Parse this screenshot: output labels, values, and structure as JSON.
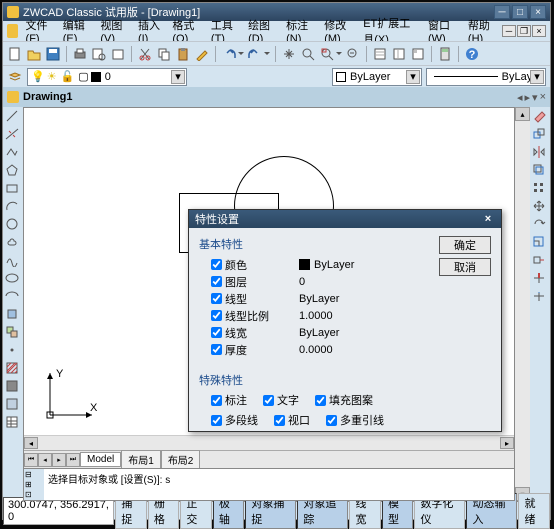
{
  "title": "ZWCAD Classic 试用版 - [Drawing1]",
  "menus": [
    "文件(F)",
    "编辑(E)",
    "视图(V)",
    "插入(I)",
    "格式(O)",
    "工具(T)",
    "绘图(D)",
    "标注(N)",
    "修改(M)",
    "ET扩展工具(X)",
    "窗口(W)",
    "帮助(H)"
  ],
  "doc_tab": "Drawing1",
  "layer_combo": "0",
  "color_combo": "ByLayer",
  "linetype_combo": "ByLayer",
  "model_tabs": [
    "Model",
    "布局1",
    "布局2"
  ],
  "cmd_text": "选择目标对象或 [设置(S)]: s",
  "coords": "300.0747, 356.2917, 0",
  "status_buttons": [
    "捕捉",
    "栅格",
    "正交",
    "极轴",
    "对象捕捉",
    "对象追踪",
    "线宽",
    "模型",
    "数字化仪",
    "动态输入",
    "就绪"
  ],
  "status_active": [
    false,
    false,
    false,
    true,
    true,
    true,
    false,
    true,
    false,
    true,
    false
  ],
  "dialog": {
    "title": "特性设置",
    "section1": "基本特性",
    "rows": [
      {
        "label": "颜色",
        "value": "ByLayer",
        "swatch": true
      },
      {
        "label": "图层",
        "value": "0"
      },
      {
        "label": "线型",
        "value": "ByLayer"
      },
      {
        "label": "线型比例",
        "value": "1.0000"
      },
      {
        "label": "线宽",
        "value": "ByLayer"
      },
      {
        "label": "厚度",
        "value": "0.0000"
      }
    ],
    "section2": "特殊特性",
    "special": [
      "标注",
      "文字",
      "填充图案",
      "多段线",
      "视口",
      "多重引线"
    ],
    "ok": "确定",
    "cancel": "取消"
  }
}
